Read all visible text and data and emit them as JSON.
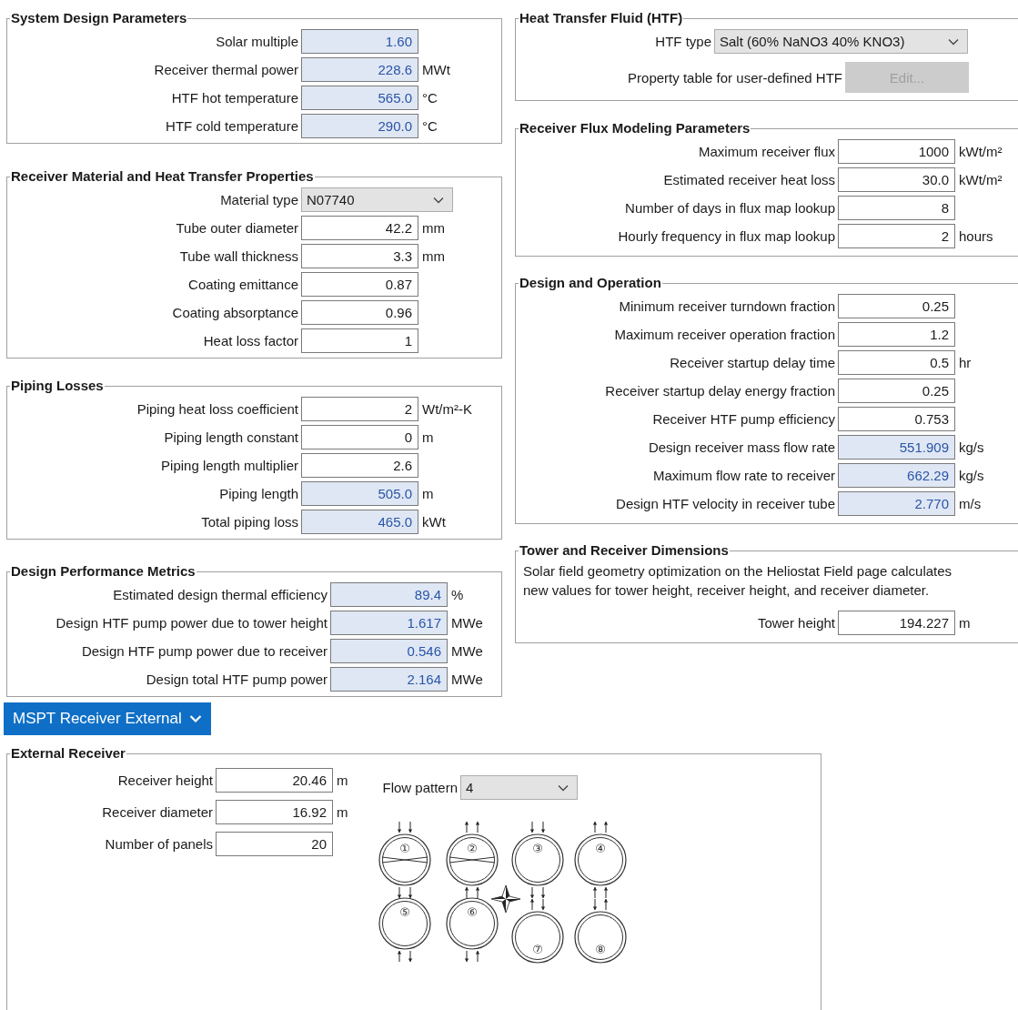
{
  "left_groups": [
    {
      "title": "System Design Parameters",
      "rows": [
        {
          "kind": "number",
          "label": "Solar multiple",
          "value": "1.60",
          "computed": true
        },
        {
          "kind": "number",
          "label": "Receiver thermal power",
          "value": "228.6",
          "unit": "MWt",
          "computed": true
        },
        {
          "kind": "number",
          "label": "HTF hot temperature",
          "value": "565.0",
          "unit": "°C",
          "computed": true
        },
        {
          "kind": "number",
          "label": "HTF cold temperature",
          "value": "290.0",
          "unit": "°C",
          "computed": true
        }
      ]
    },
    {
      "title": "Receiver Material and Heat Transfer Properties",
      "rows": [
        {
          "kind": "dropdown",
          "label": "Material type",
          "value": "N07740"
        },
        {
          "kind": "number",
          "label": "Tube outer diameter",
          "value": "42.2",
          "unit": "mm",
          "computed": false
        },
        {
          "kind": "number",
          "label": "Tube wall thickness",
          "value": "3.3",
          "unit": "mm",
          "computed": false
        },
        {
          "kind": "number",
          "label": "Coating emittance",
          "value": "0.87",
          "computed": false
        },
        {
          "kind": "number",
          "label": "Coating absorptance",
          "value": "0.96",
          "computed": false
        },
        {
          "kind": "number",
          "label": "Heat loss factor",
          "value": "1",
          "computed": false
        }
      ]
    },
    {
      "title": "Piping Losses",
      "rows": [
        {
          "kind": "number",
          "label": "Piping heat loss coefficient",
          "value": "2",
          "unit": "Wt/m²-K",
          "computed": false
        },
        {
          "kind": "number",
          "label": "Piping length constant",
          "value": "0",
          "unit": "m",
          "computed": false
        },
        {
          "kind": "number",
          "label": "Piping length multiplier",
          "value": "2.6",
          "computed": false
        },
        {
          "kind": "number",
          "label": "Piping length",
          "value": "505.0",
          "unit": "m",
          "computed": true
        },
        {
          "kind": "number",
          "label": "Total piping loss",
          "value": "465.0",
          "unit": "kWt",
          "computed": true
        }
      ]
    },
    {
      "title": "Design Performance Metrics",
      "rows": [
        {
          "kind": "number",
          "label": "Estimated design thermal efficiency",
          "value": "89.4",
          "unit": "%",
          "computed": true
        },
        {
          "kind": "number",
          "label": "Design HTF pump power due to tower height",
          "value": "1.617",
          "unit": "MWe",
          "computed": true
        },
        {
          "kind": "number",
          "label": "Design HTF pump power due to receiver",
          "value": "0.546",
          "unit": "MWe",
          "computed": true
        },
        {
          "kind": "number",
          "label": "Design total HTF pump power",
          "value": "2.164",
          "unit": "MWe",
          "computed": true
        }
      ]
    }
  ],
  "right_groups": [
    {
      "title": "Heat Transfer Fluid (HTF)",
      "rows": [
        {
          "kind": "dropdown",
          "label": "HTF type",
          "value": "Salt (60% NaNO3 40% KNO3)"
        },
        {
          "kind": "button",
          "label": "Property table for user-defined HTF",
          "value": "Edit...",
          "disabled": true
        }
      ]
    },
    {
      "title": "Receiver Flux Modeling Parameters",
      "rows": [
        {
          "kind": "number",
          "label": "Maximum receiver flux",
          "value": "1000",
          "unit": "kWt/m²",
          "computed": false
        },
        {
          "kind": "number",
          "label": "Estimated receiver heat loss",
          "value": "30.0",
          "unit": "kWt/m²",
          "computed": false
        },
        {
          "kind": "number",
          "label": "Number of days in flux map lookup",
          "value": "8",
          "computed": false
        },
        {
          "kind": "number",
          "label": "Hourly frequency in flux map lookup",
          "value": "2",
          "unit": "hours",
          "computed": false
        }
      ]
    },
    {
      "title": "Design and Operation",
      "rows": [
        {
          "kind": "number",
          "label": "Minimum receiver turndown fraction",
          "value": "0.25",
          "computed": false
        },
        {
          "kind": "number",
          "label": "Maximum receiver operation fraction",
          "value": "1.2",
          "computed": false
        },
        {
          "kind": "number",
          "label": "Receiver startup delay time",
          "value": "0.5",
          "unit": "hr",
          "computed": false
        },
        {
          "kind": "number",
          "label": "Receiver startup delay energy fraction",
          "value": "0.25",
          "computed": false
        },
        {
          "kind": "number",
          "label": "Receiver HTF pump efficiency",
          "value": "0.753",
          "computed": false
        },
        {
          "kind": "number",
          "label": "Design receiver mass flow rate",
          "value": "551.909",
          "unit": "kg/s",
          "computed": true
        },
        {
          "kind": "number",
          "label": "Maximum flow rate to receiver",
          "value": "662.29",
          "unit": "kg/s",
          "computed": true
        },
        {
          "kind": "number",
          "label": "Design HTF velocity in receiver tube",
          "value": "2.770",
          "unit": "m/s",
          "computed": true
        }
      ]
    },
    {
      "title": "Tower and Receiver Dimensions",
      "rows": [
        {
          "kind": "note",
          "label": "Solar field geometry optimization on the Heliostat Field page calculates new values for tower height, receiver height, and receiver diameter."
        },
        {
          "kind": "number",
          "label": "Tower height",
          "value": "194.227",
          "unit": "m",
          "computed": false
        }
      ]
    }
  ],
  "section_button": {
    "label": "MSPT Receiver External",
    "expanded": true
  },
  "external_receiver": {
    "title": "External Receiver",
    "rows": [
      {
        "kind": "number",
        "label": "Receiver height",
        "value": "20.46",
        "unit": "m",
        "computed": false
      },
      {
        "kind": "number",
        "label": "Receiver diameter",
        "value": "16.92",
        "unit": "m",
        "computed": false
      },
      {
        "kind": "number",
        "label": "Number of panels",
        "value": "20",
        "computed": false
      }
    ],
    "flow_pattern": {
      "kind": "dropdown",
      "label": "Flow pattern",
      "value": "4"
    },
    "diagram_labels": [
      "①",
      "②",
      "③",
      "④",
      "⑤",
      "⑥",
      "⑦",
      "⑧"
    ]
  }
}
